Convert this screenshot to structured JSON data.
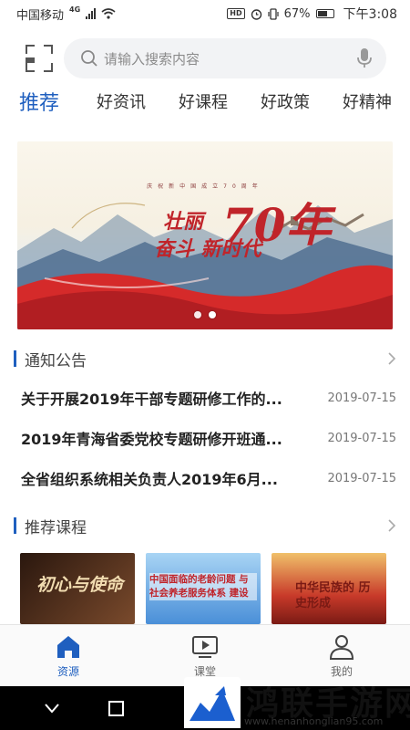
{
  "status_bar": {
    "carrier": "中国移动",
    "network": "4G",
    "battery": "67%",
    "time": "下午3:08"
  },
  "search": {
    "placeholder": "请输入搜索内容"
  },
  "tabs": [
    {
      "label": "推荐",
      "active": true
    },
    {
      "label": "好资讯",
      "active": false
    },
    {
      "label": "好课程",
      "active": false
    },
    {
      "label": "好政策",
      "active": false
    },
    {
      "label": "好精神",
      "active": false
    }
  ],
  "banner": {
    "small_text": "庆祝新中国成立70周年",
    "title_a": "壮丽",
    "title_num": "70年",
    "title_b": "奋斗 新时代",
    "page_count": 2,
    "active_page": 0
  },
  "notices": {
    "title": "通知公告",
    "items": [
      {
        "title": "关于开展2019年干部专题研修工作的...",
        "date": "2019-07-15"
      },
      {
        "title": "2019年青海省委党校专题研修开班通...",
        "date": "2019-07-15"
      },
      {
        "title": "全省组织系统相关负责人2019年6月...",
        "date": "2019-07-15"
      }
    ]
  },
  "courses": {
    "title": "推荐课程",
    "items": [
      {
        "text": "初心与使命",
        "colors": [
          "#3a2418",
          "#7a4a2c"
        ]
      },
      {
        "text": "中国面临的老龄问题 与社会养老服务体系 建设",
        "colors": [
          "#4a8fd8",
          "#a8d4f4"
        ]
      },
      {
        "text": "中华民族的 历史形成",
        "colors": [
          "#7a1a14",
          "#c83a2a"
        ]
      }
    ]
  },
  "bottom_nav": [
    {
      "label": "资源",
      "icon": "home-icon",
      "active": true
    },
    {
      "label": "课堂",
      "icon": "play-icon",
      "active": false
    },
    {
      "label": "我的",
      "icon": "user-icon",
      "active": false
    }
  ],
  "watermark": {
    "text": "鸿联手游网",
    "url": "www.henanhonglian95.com"
  },
  "colors": {
    "accent": "#1f5fbf",
    "banner_red": "#c0242a"
  }
}
